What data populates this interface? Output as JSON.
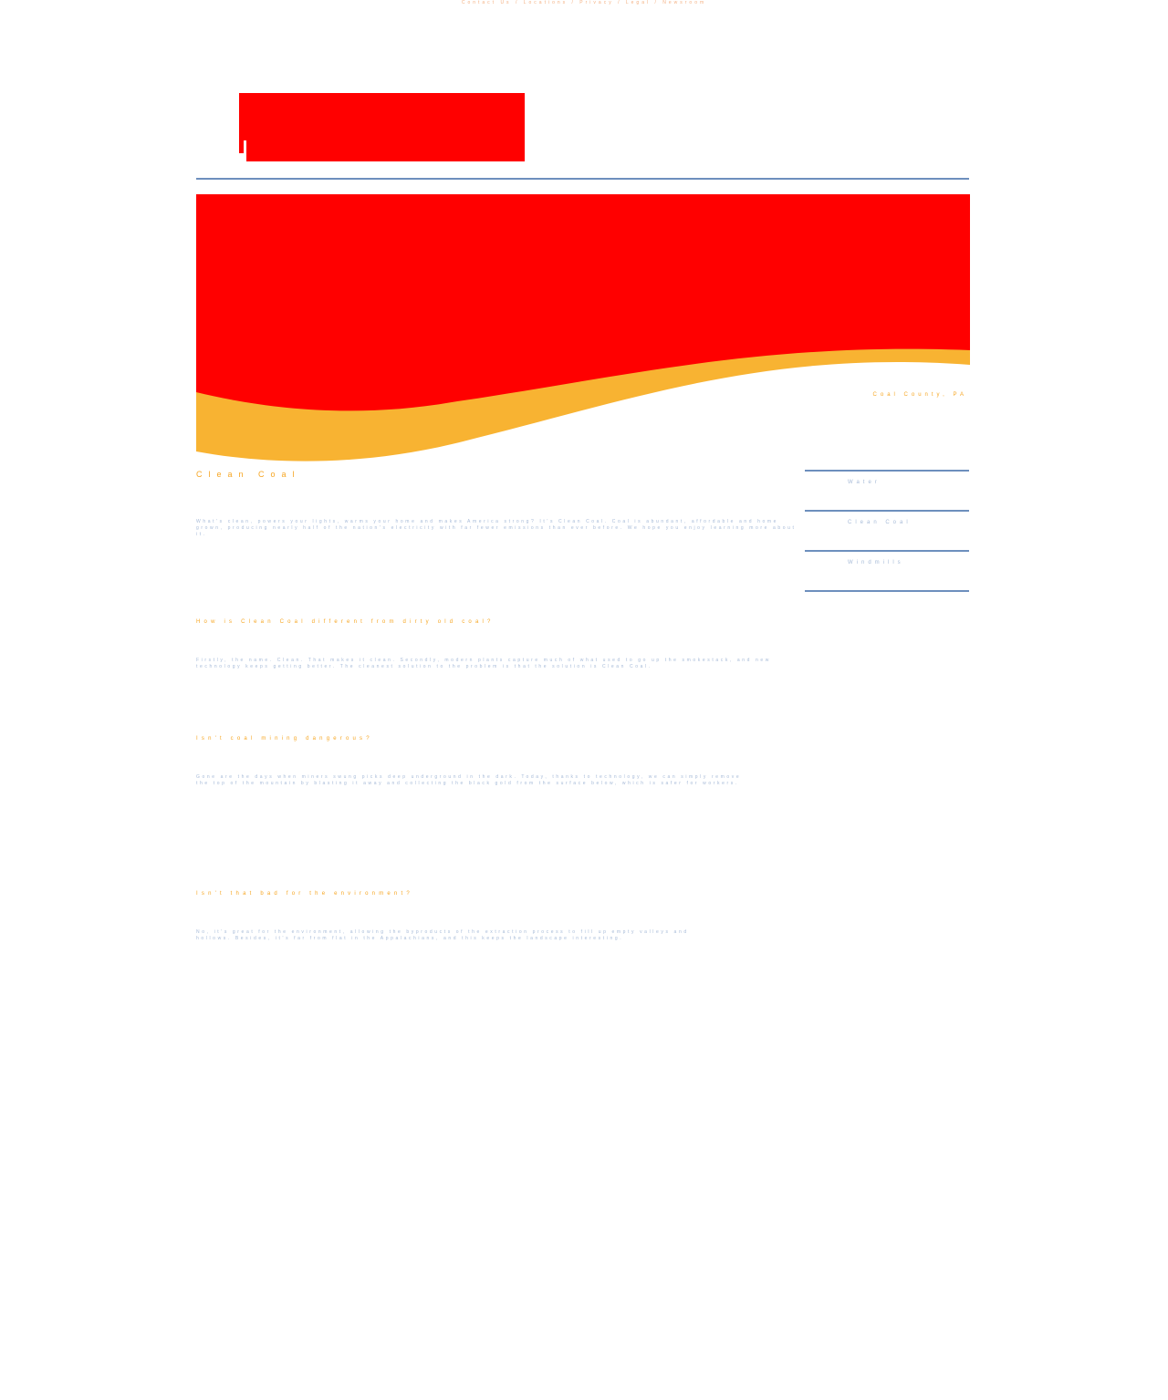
{
  "header": {
    "top_note": "Contact Us / Locations / Privacy / Legal / Newsroom",
    "logo_name": "red-logo-block"
  },
  "hero": {
    "colors": {
      "primary": "#ff0000",
      "accent": "#f8b332"
    },
    "location": "Coal County, PA"
  },
  "main": {
    "title": "Clean Coal",
    "intro": "What's clean, powers your lights, warms your home and makes America strong? It's Clean Coal. Coal is abundant, affordable and home grown, producing nearly half of the nation's electricity with far fewer emissions than ever before. We hope you enjoy learning more about it.",
    "sections": [
      {
        "heading": "How is Clean Coal different from dirty old coal?",
        "body": "Firstly, the name. Clean. That makes it clean. Secondly, modern plants capture much of what used to go up the smokestack, and new technology keeps getting better. The cleanest solution to the problem is that the solution is Clean Coal."
      },
      {
        "heading": "Isn't coal mining dangerous?",
        "body": "Gone are the days when miners swung picks deep underground in the dark. Today, thanks to technology, we can simply remove the top of the mountain by blasting it away and collecting the black gold from the surface below, which is safer for workers."
      },
      {
        "heading": "Isn't that bad for the environment?",
        "body": "No, it's great for the environment, allowing the byproducts of the extraction process to fill up empty valleys and hollows. Besides, it's far from flat in the Appalachians, and this keeps the landscape interesting."
      }
    ]
  },
  "sidebar": {
    "items": [
      {
        "label": "Water"
      },
      {
        "label": "Clean Coal"
      },
      {
        "label": "Windmills"
      }
    ]
  }
}
